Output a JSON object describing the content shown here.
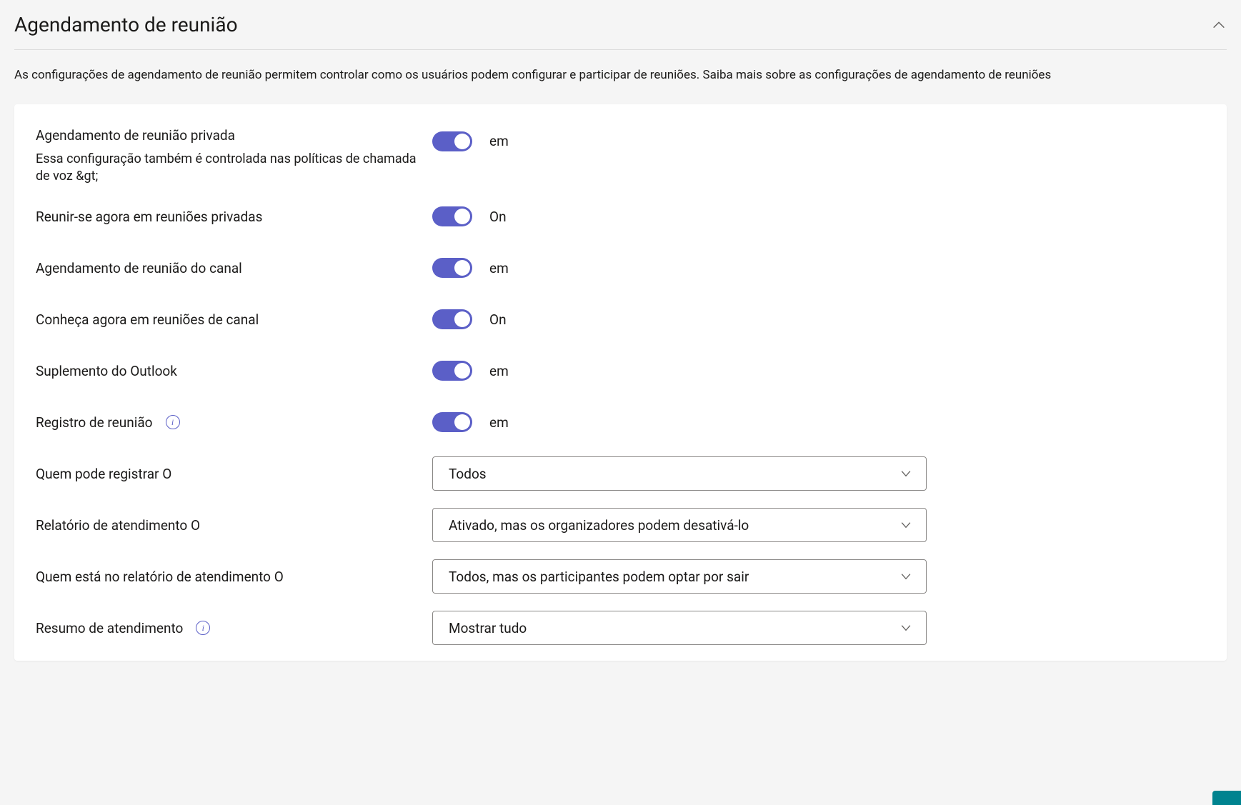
{
  "section": {
    "title": "Agendamento de reunião",
    "description": "As configurações de agendamento de reunião permitem controlar como os usuários podem configurar e participar de reuniões. Saiba mais sobre as configurações de agendamento de reuniões"
  },
  "settings": {
    "private_meeting_scheduling": {
      "label": "Agendamento de reunião privada",
      "sublabel": "Essa configuração também é controlada nas políticas de chamada de voz &gt;",
      "state_label": "em"
    },
    "meet_now_private": {
      "label": "Reunir-se agora em reuniões privadas",
      "state_label": "On"
    },
    "channel_meeting_scheduling": {
      "label": "Agendamento de reunião do canal",
      "state_label": "em"
    },
    "meet_now_channel": {
      "label": "Conheça agora em reuniões de canal",
      "state_label": "On"
    },
    "outlook_addin": {
      "label": "Suplemento do Outlook",
      "state_label": "em"
    },
    "registration": {
      "label": "Registro de reunião",
      "state_label": "em"
    },
    "who_can_register": {
      "label": "Quem pode registrar O",
      "value": "Todos"
    },
    "attendance_report": {
      "label": "Relatório de atendimento O",
      "value": "Ativado, mas os organizadores podem desativá-lo"
    },
    "who_in_report": {
      "label": "Quem está no relatório de atendimento O",
      "value": "Todos, mas os participantes podem optar por sair"
    },
    "attendance_summary": {
      "label": "Resumo de atendimento",
      "value": "Mostrar tudo"
    }
  }
}
